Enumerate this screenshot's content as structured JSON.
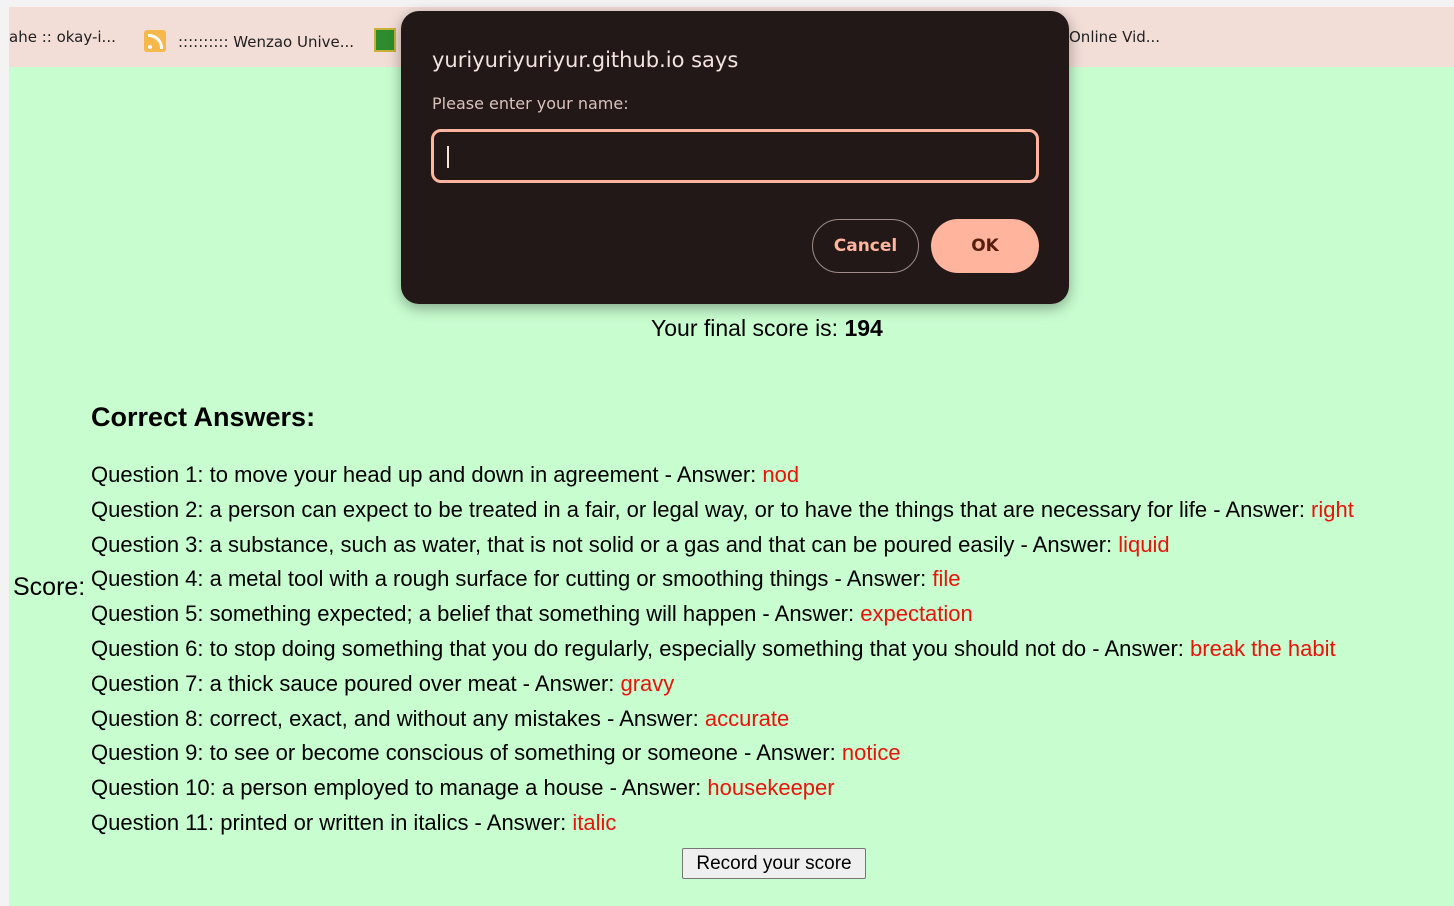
{
  "bookmarks": [
    {
      "label": "ahe :: okay-i..."
    },
    {
      "label": ":::::::::: Wenzao Unive...",
      "icon": "rss-icon"
    },
    {
      "label": "",
      "icon": "green-site-icon"
    },
    {
      "label": "Online Vid..."
    }
  ],
  "dialog": {
    "title": "yuriyuriyuriyur.github.io says",
    "message": "Please enter your name:",
    "input_value": "",
    "cancel_label": "Cancel",
    "ok_label": "OK"
  },
  "page": {
    "final_score_prefix": "Your final score is: ",
    "final_score_value": "194",
    "score_label": "Score:",
    "answers_title": "Correct Answers:",
    "questions": [
      {
        "text": "Question 1: to move your head up and down in agreement - Answer: ",
        "answer": "nod"
      },
      {
        "text": "Question 2: a person can expect to be treated in a fair, or legal way, or to have the things that are necessary for life - Answer: ",
        "answer": "right"
      },
      {
        "text": "Question 3: a substance, such as water, that is not solid or a gas and that can be poured easily - Answer: ",
        "answer": "liquid"
      },
      {
        "text": "Question 4: a metal tool with a rough surface for cutting or smoothing things - Answer: ",
        "answer": "file"
      },
      {
        "text": "Question 5: something expected; a belief that something will happen - Answer: ",
        "answer": "expectation"
      },
      {
        "text": "Question 6: to stop doing something that you do regularly, especially something that you should not do - Answer: ",
        "answer": "break the habit"
      },
      {
        "text": "Question 7: a thick sauce poured over meat - Answer: ",
        "answer": "gravy"
      },
      {
        "text": "Question 8: correct, exact, and without any mistakes - Answer: ",
        "answer": "accurate"
      },
      {
        "text": "Question 9: to see or become conscious of something or someone - Answer: ",
        "answer": "notice"
      },
      {
        "text": "Question 10: a person employed to manage a house - Answer: ",
        "answer": "housekeeper"
      },
      {
        "text": "Question 11: printed or written in italics - Answer: ",
        "answer": "italic"
      }
    ],
    "record_button_label": "Record your score"
  },
  "colors": {
    "page_background": "#c8fdd0",
    "bookmark_bar": "#f2ddd7",
    "answer_text": "#e8140c",
    "dialog_background": "#231818",
    "dialog_accent": "#ffb49e"
  }
}
